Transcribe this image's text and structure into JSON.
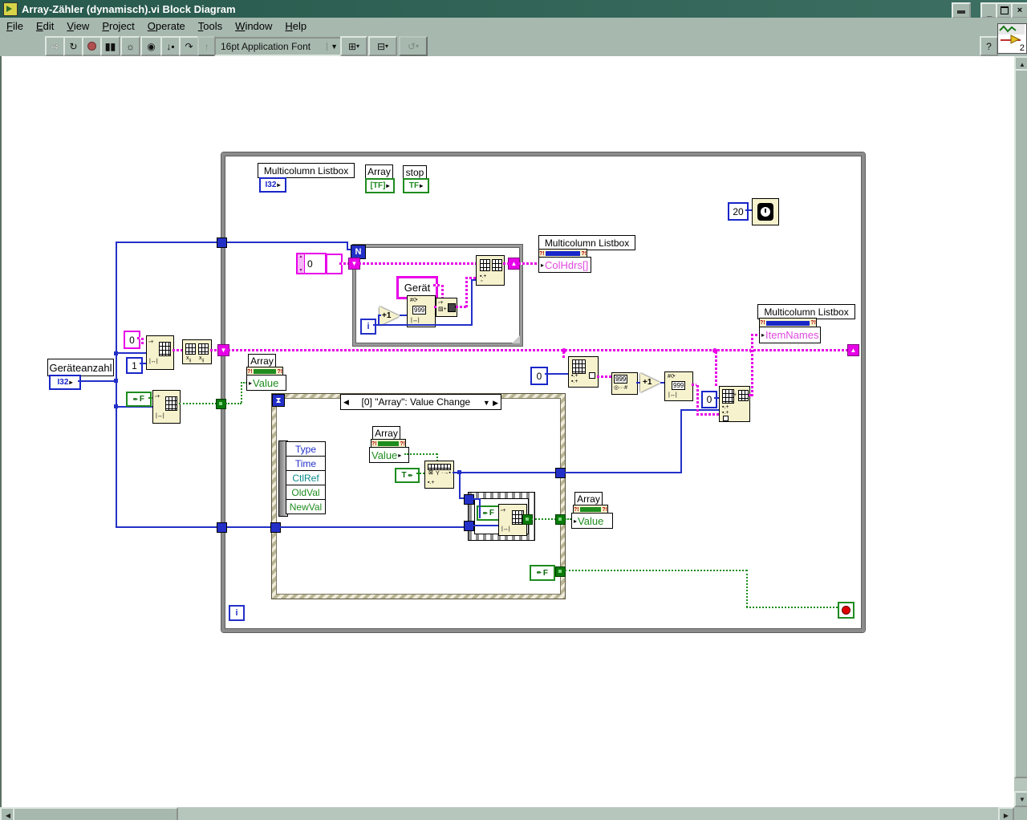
{
  "window": {
    "title": "Array-Zähler (dynamisch).vi Block Diagram",
    "menu": [
      "File",
      "Edit",
      "View",
      "Project",
      "Operate",
      "Tools",
      "Window",
      "Help"
    ],
    "toolbar": {
      "font_selector": "16pt Application Font"
    },
    "help_button": "?",
    "vi_icon_badge": "2"
  },
  "diagram": {
    "terminals": {
      "listbox_label": "Multicolumn Listbox",
      "listbox_type": "I32",
      "array_label": "Array",
      "array_type": "[TF]",
      "stop_label": "stop",
      "stop_type": "TF"
    },
    "wait": {
      "value": "20"
    },
    "for_loop": {
      "count": "N",
      "iteration": "i",
      "scroll_constant": "0",
      "device_string": "Gerät",
      "increment": "+1",
      "digits": "999"
    },
    "colhdrs": {
      "label": "Multicolumn Listbox",
      "property": "ColHdrs[]"
    },
    "itemnames": {
      "label": "Multicolumn Listbox",
      "property": "ItemNames"
    },
    "device_count": {
      "label": "Geräteanzahl",
      "type": "I32"
    },
    "left_consts": {
      "zero": "0",
      "one": "1",
      "false_const": "F"
    },
    "array_value_outer": {
      "label": "Array",
      "property": "Value"
    },
    "event": {
      "header": "[0] \"Array\": Value Change",
      "data_fields": [
        "Type",
        "Time",
        "CtlRef",
        "OldVal",
        "NewVal"
      ],
      "array_read": {
        "label": "Array",
        "property": "Value"
      },
      "true_const": "T",
      "seq_false": "F",
      "array_write": {
        "label": "Array",
        "property": "Value"
      },
      "stop_false": "F"
    },
    "update_chain": {
      "index_zero": "0",
      "digits": "999",
      "increment": "+1",
      "replace_zero": "0"
    },
    "while_loop": {
      "iteration": "i"
    }
  }
}
